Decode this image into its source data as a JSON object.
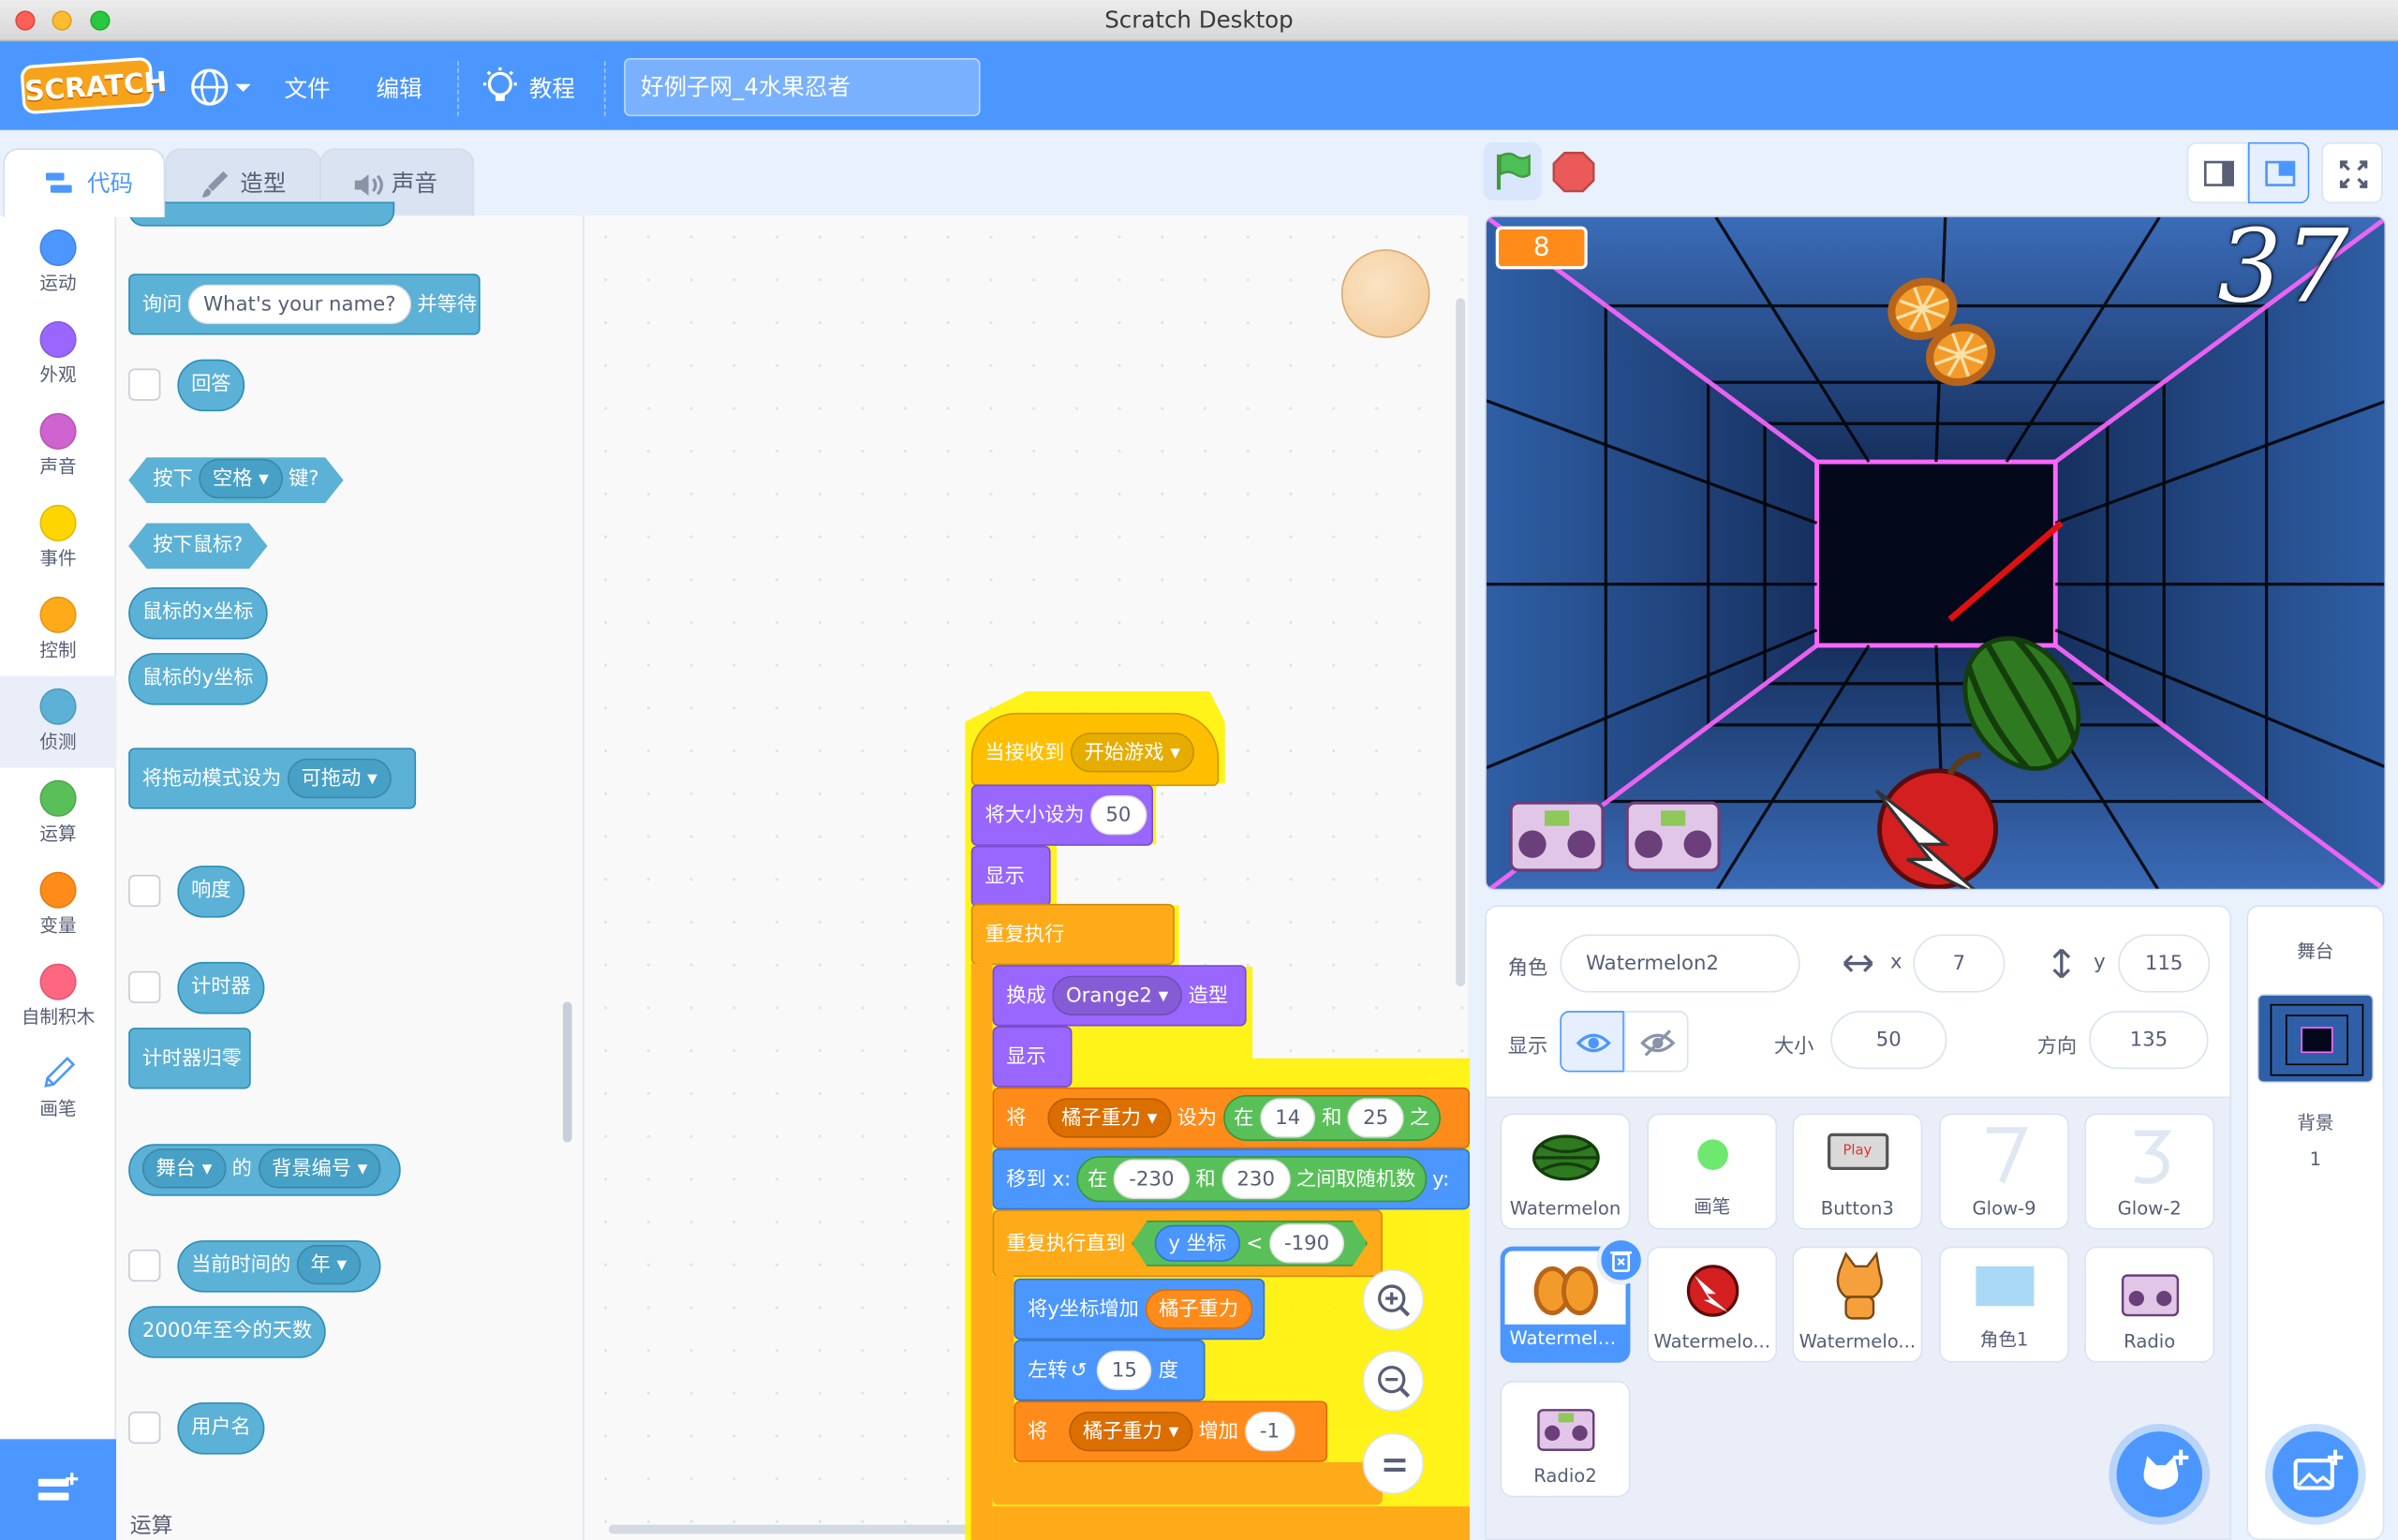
{
  "window": {
    "title": "Scratch Desktop"
  },
  "menubar": {
    "file": "文件",
    "edit": "编辑",
    "tutorials": "教程",
    "project_name": "好例子网_4水果忍者",
    "logo": "SCRATCH"
  },
  "tabs": {
    "code": "代码",
    "costumes": "造型",
    "sounds": "声音"
  },
  "categories": [
    {
      "label": "运动",
      "color": "#4c97ff"
    },
    {
      "label": "外观",
      "color": "#9966ff"
    },
    {
      "label": "声音",
      "color": "#cf63cf"
    },
    {
      "label": "事件",
      "color": "#ffd500"
    },
    {
      "label": "控制",
      "color": "#ffab19"
    },
    {
      "label": "侦测",
      "color": "#5cb1d6"
    },
    {
      "label": "运算",
      "color": "#59c059"
    },
    {
      "label": "变量",
      "color": "#ff8c1a"
    },
    {
      "label": "自制积木",
      "color": "#ff6680"
    },
    {
      "label": "画笔",
      "color": "#0fbd8c"
    }
  ],
  "palette": {
    "ask": "询问",
    "ask_default": "What's your name?",
    "ask_wait": "并等待",
    "answer": "回答",
    "key_press": "按下",
    "key_space": "空格",
    "key_suffix": "键?",
    "mouse_down": "按下鼠标?",
    "mouse_x": "鼠标的x坐标",
    "mouse_y": "鼠标的y坐标",
    "drag_mode": "将拖动模式设为",
    "drag_value": "可拖动",
    "loudness": "响度",
    "timer": "计时器",
    "reset_timer": "计时器归零",
    "stage": "舞台",
    "of": "的",
    "backdrop_number": "背景编号",
    "current_time": "当前时间的",
    "year": "年",
    "days_since": "2000年至今的天数",
    "username": "用户名",
    "operators_heading": "运算"
  },
  "script": {
    "when_receive": "当接收到",
    "msg": "开始游戏",
    "set_size": "将大小设为",
    "size_val": "50",
    "show1": "显示",
    "forever": "重复执行",
    "switch_costume": "换成",
    "costume": "Orange2",
    "costume_suffix": "造型",
    "show2": "显示",
    "set_var": "将",
    "var_name": "橘子重力",
    "set_to": "设为",
    "in": "在",
    "r1": "14",
    "and": "和",
    "r2": "25",
    "between": "之",
    "goto_x": "移到 x:",
    "in2": "在",
    "x1": "-230",
    "and2": "和",
    "x2": "230",
    "rand": "之间取随机数",
    "y": "y:",
    "repeat_until": "重复执行直到",
    "ycoord": "y 坐标",
    "lt": "<",
    "yval": "-190",
    "change_y": "将y坐标增加",
    "change_y_var": "橘子重力",
    "turn_left": "左转",
    "turn_deg": "15",
    "deg": "度",
    "change_var": "将",
    "change_var_name": "橘子重力",
    "change_by": "增加",
    "change_val": "-1"
  },
  "stage": {
    "score_monitor": "8",
    "timer_text": "37"
  },
  "sprite_info": {
    "sprite_label": "角色",
    "sprite_name": "Watermelon2",
    "x_label": "x",
    "x": "7",
    "y_label": "y",
    "y": "115",
    "show_label": "显示",
    "size_label": "大小",
    "size": "50",
    "direction_label": "方向",
    "direction": "135"
  },
  "sprites": [
    {
      "name": "Watermelon"
    },
    {
      "name": "画笔"
    },
    {
      "name": "Button3"
    },
    {
      "name": "Glow-9"
    },
    {
      "name": "Glow-2"
    },
    {
      "name": "Watermelo..."
    },
    {
      "name": "Watermelo..."
    },
    {
      "name": "Watermelo..."
    },
    {
      "name": "角色1"
    },
    {
      "name": "Radio"
    },
    {
      "name": "Radio2"
    }
  ],
  "stage_panel": {
    "title": "舞台",
    "backdrops_label": "背景",
    "backdrops_count": "1"
  },
  "button3_text": "Play",
  "colors": {
    "menubar": "#4c97ff",
    "events": "#ffbf00",
    "control": "#ffab19",
    "looks": "#9966ff",
    "variables": "#ff8c1a",
    "operators": "#59c059",
    "motion": "#4c97ff",
    "sensing": "#5cb1d6"
  }
}
